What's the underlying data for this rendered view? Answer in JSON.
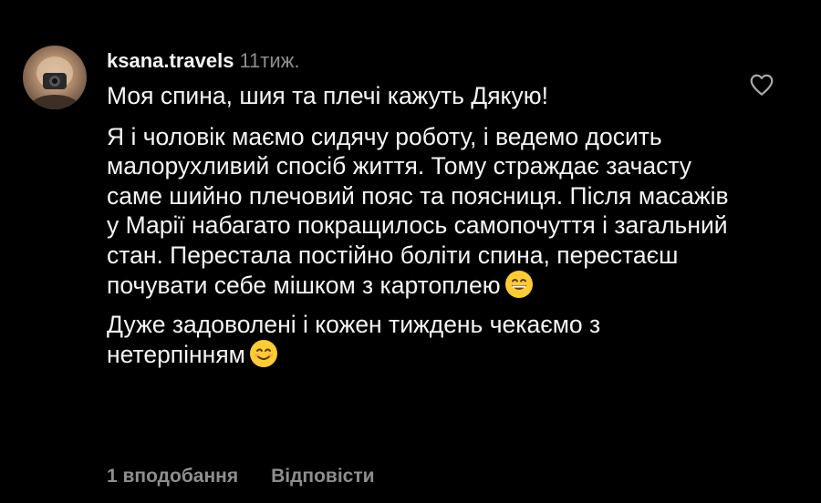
{
  "comment": {
    "username": "ksana.travels",
    "time": "11тиж.",
    "paragraphs": [
      "Моя спина, шия та плечі кажуть Дякую!",
      "Я і чоловік маємо сидячу роботу, і ведемо досить малорухливий спосіб життя. Тому страждає зачасту саме шийно плечовий пояс та поясниця. Після масажів у Марії набагато покращилось самопочуття і загальний стан. Перестала постійно боліти спина, перестаєш почувати себе мішком з картоплею",
      "Дуже задоволені і кожен тиждень чекаємо з нетерпінням"
    ],
    "emojis": [
      "grinning-face-emoji",
      "smiling-face-emoji"
    ],
    "likes": "1 вподобання",
    "reply": "Відповісти"
  },
  "icons": {
    "like": "heart-outline-icon"
  },
  "colors": {
    "background": "#000000",
    "text": "#f5f5f5",
    "secondary": "#8e8e8e",
    "emoji": "#ffcc33"
  }
}
